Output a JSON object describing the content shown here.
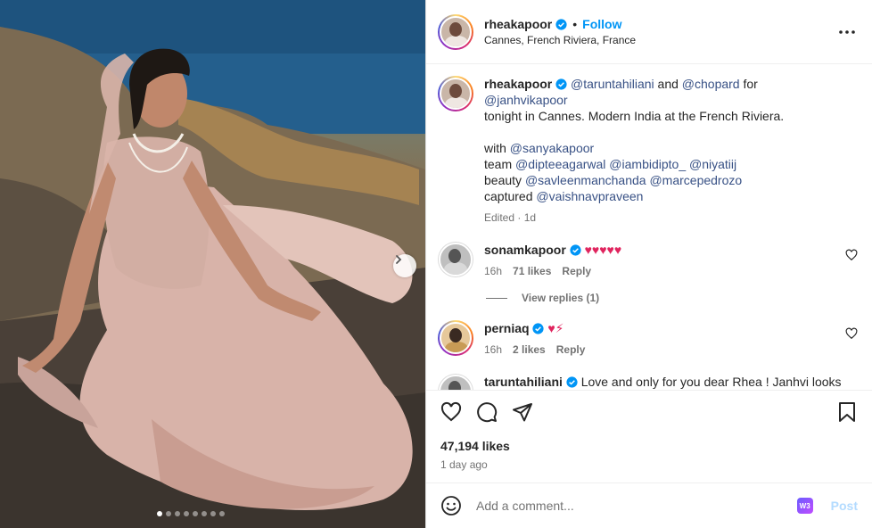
{
  "post": {
    "username": "rheakapoor",
    "follow_label": "Follow",
    "separator": "•",
    "location": "Cannes, French Riviera, France",
    "more_icon": "more-horizontal-icon",
    "carousel_pages": 8,
    "carousel_current": 1
  },
  "caption": {
    "username": "rheakapoor",
    "m1": "@taruntahiliani",
    "and": "and",
    "m2": "@chopard",
    "for": "for",
    "m3": "@janhvikapoor",
    "line2": "tonight in Cannes. Modern India at the French Riviera.",
    "with_label": "with",
    "with_m": "@sanyakapoor",
    "team_label": "team",
    "team_m1": "@dipteeagarwal",
    "team_m2": "@iambidipto_",
    "team_m3": "@niyatiij",
    "beauty_label": "beauty",
    "beauty_m1": "@savleenmanchanda",
    "beauty_m2": "@marcepedrozo",
    "captured_label": "captured",
    "captured_m": "@vaishnavpraveen",
    "edited": "Edited · 1d"
  },
  "comments": [
    {
      "username": "sonamkapoor",
      "text": "♥♥♥♥♥",
      "time": "16h",
      "likes": "71 likes",
      "reply": "Reply",
      "view_replies": "View replies (1)"
    },
    {
      "username": "perniaq",
      "text": "♥⚡",
      "time": "16h",
      "likes": "2 likes",
      "reply": "Reply"
    },
    {
      "username": "taruntahiliani",
      "text": "Love and only for you dear Rhea ! Janhvi looks"
    }
  ],
  "footer": {
    "likes": "47,194 likes",
    "ago": "1 day ago",
    "comment_placeholder": "Add a comment...",
    "post_label": "Post",
    "ext_label": "W3"
  },
  "colors": {
    "link": "#0095f6",
    "mention": "#385185",
    "muted": "#737373",
    "heart": "#e0245e"
  }
}
